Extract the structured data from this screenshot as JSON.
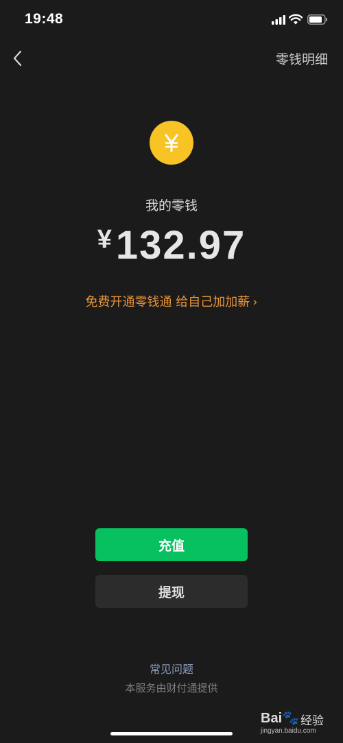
{
  "status_bar": {
    "time": "19:48"
  },
  "nav": {
    "back_icon": "chevron-left-icon",
    "right_label": "零钱明细"
  },
  "balance": {
    "icon": "yuan-coin-icon",
    "icon_color": "#f7c325",
    "title": "我的零钱",
    "currency_symbol": "¥",
    "amount": "132.97"
  },
  "promo": {
    "text": "免费开通零钱通 给自己加加薪",
    "chevron": "›",
    "color": "#e8953a"
  },
  "actions": {
    "recharge_label": "充值",
    "recharge_color": "#07c160",
    "withdraw_label": "提现"
  },
  "footer": {
    "faq_label": "常见问题",
    "provider_text": "本服务由财付通提供"
  },
  "watermark": {
    "logo": "Bai🐾",
    "text": "经验",
    "url": "jingyan.baidu.com"
  }
}
